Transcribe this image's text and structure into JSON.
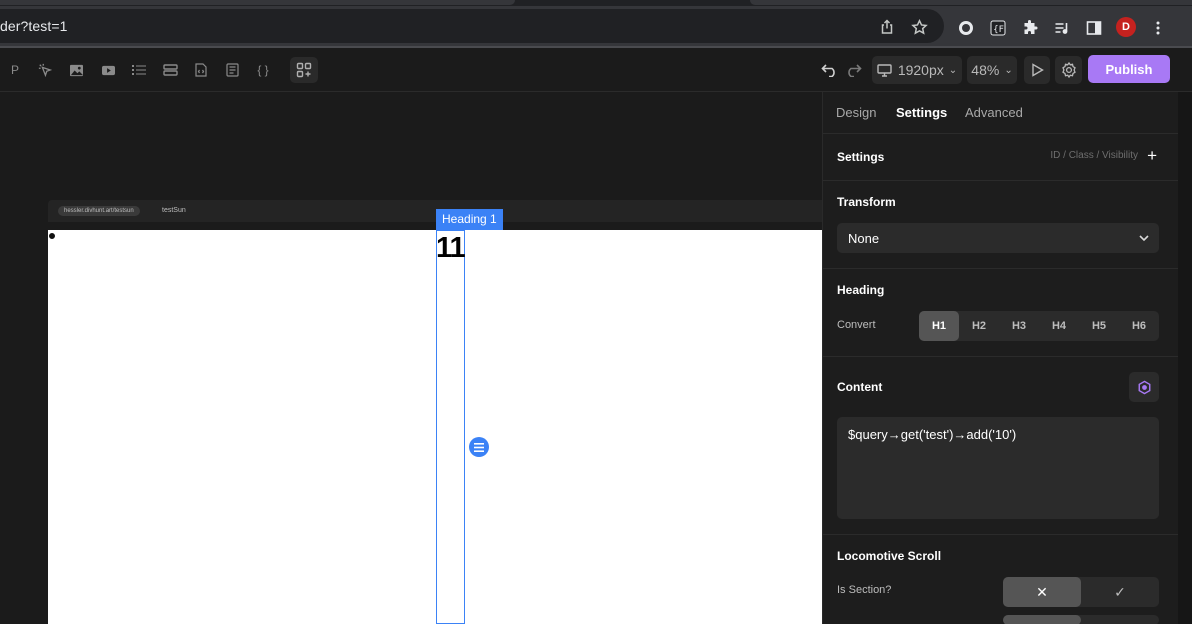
{
  "browser": {
    "url": "der?test=1",
    "share_icon": "share-icon",
    "bookmark_icon": "star-icon",
    "avatar_letter": "D",
    "avatar_color": "#c5221f"
  },
  "toolbar": {
    "paragraph_label": "P",
    "code_label": "{ }",
    "viewport_label": "1920px",
    "zoom_label": "48%",
    "publish_label": "Publish",
    "publish_color": "#a879f5"
  },
  "canvas": {
    "frame_url": "hessler.divhunt.art/testsun",
    "frame_label": "testSun",
    "heading_tag": "Heading 1",
    "heading_text": "11",
    "selection_color": "#3b82f6"
  },
  "panel": {
    "tabs": [
      {
        "label": "Design"
      },
      {
        "label": "Settings"
      },
      {
        "label": "Advanced"
      }
    ],
    "settings": {
      "title": "Settings",
      "meta": "ID / Class / Visibility"
    },
    "transform": {
      "title": "Transform",
      "value": "None"
    },
    "heading": {
      "title": "Heading",
      "convert_label": "Convert",
      "levels": [
        "H1",
        "H2",
        "H3",
        "H4",
        "H5",
        "H6"
      ],
      "selected": "H1"
    },
    "content": {
      "title": "Content",
      "value": "$query→get('test')→add('10')"
    },
    "locomotive": {
      "title": "Locomotive Scroll",
      "is_section_label": "Is Section?",
      "off_symbol": "✕",
      "on_symbol": "✓"
    }
  }
}
